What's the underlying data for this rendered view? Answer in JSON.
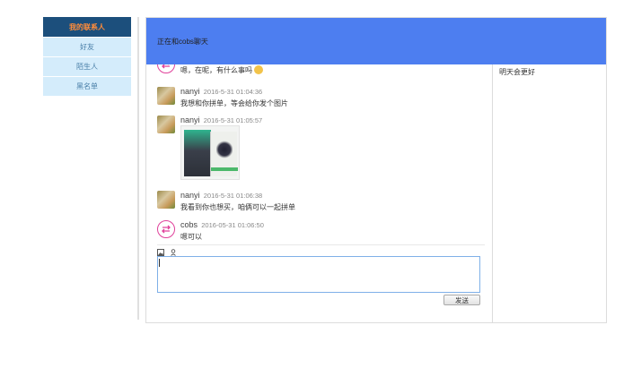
{
  "nav": {
    "header": "我的联系人",
    "items": [
      {
        "label": "好友"
      },
      {
        "label": "陌生人"
      },
      {
        "label": "黑名单"
      }
    ]
  },
  "chat": {
    "header_title": "正在和cobs聊天",
    "notice": "明天会更好",
    "messages": [
      {
        "name": "",
        "time": "",
        "text": "嗯，在呢，有什么事吗",
        "avatar": "cobs-icon",
        "has_emoji": true
      },
      {
        "name": "nanyi",
        "time": "2016-5-31 01:04:36",
        "text": "我想和你拼单，等会给你发个图片",
        "avatar": "photo"
      },
      {
        "name": "nanyi",
        "time": "2016-5-31 01:05:57",
        "text": "",
        "avatar": "photo",
        "has_image": true
      },
      {
        "name": "nanyi",
        "time": "2016-5-31 01:06:38",
        "text": "我看到你也想买，咱俩可以一起拼单",
        "avatar": "photo"
      },
      {
        "name": "cobs",
        "time": "2016-05-31 01:06:50",
        "text": "嗯可以",
        "avatar": "cobs-icon"
      }
    ],
    "input_value": "",
    "send_label": "发送"
  },
  "colors": {
    "header_bg": "#4d7ef0",
    "nav_head_bg": "#1c4f7c",
    "nav_head_text": "#ff8c3a",
    "nav_item_bg": "#d4ecfb",
    "cobs_accent": "#e0409a"
  }
}
